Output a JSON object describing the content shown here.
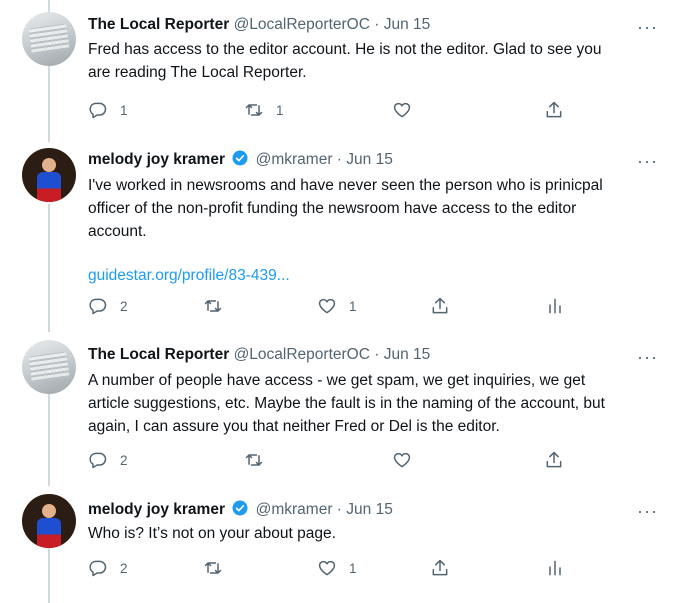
{
  "tweets": [
    {
      "name": "The Local Reporter",
      "handle": "@LocalReporterOC",
      "dot": "·",
      "date": "Jun 15",
      "verified": false,
      "lines": [
        "Fred has access to the editor account.  He is not the editor.  Glad to see you",
        "are reading The Local Reporter."
      ],
      "link": "",
      "reply_count": "1",
      "retweet_count": "1",
      "like_count": "",
      "has_analytics": false
    },
    {
      "name": "melody joy kramer",
      "handle": "@mkramer",
      "dot": "·",
      "date": "Jun 15",
      "verified": true,
      "lines": [
        "I've worked in newsrooms and have never seen the person who is prinicpal",
        "officer of the non-profit funding the newsroom have access to the editor",
        "account."
      ],
      "link": "guidestar.org/profile/83-439...",
      "reply_count": "2",
      "retweet_count": "",
      "like_count": "1",
      "has_analytics": true
    },
    {
      "name": "The Local Reporter",
      "handle": "@LocalReporterOC",
      "dot": "·",
      "date": "Jun 15",
      "verified": false,
      "lines": [
        "A number of people have access - we get spam, we get inquiries, we get",
        "article suggestions, etc.  Maybe the fault is in the naming of the account, but",
        "again, I can assure you that neither Fred or Del is the editor."
      ],
      "link": "",
      "reply_count": "2",
      "retweet_count": "",
      "like_count": "",
      "has_analytics": false
    },
    {
      "name": "melody joy kramer",
      "handle": "@mkramer",
      "dot": "·",
      "date": "Jun 15",
      "verified": true,
      "lines": [
        "Who is? It’s not on your about page."
      ],
      "link": "",
      "reply_count": "2",
      "retweet_count": "",
      "like_count": "1",
      "has_analytics": true
    }
  ],
  "icons": {
    "more": "more-icon",
    "reply": "reply-icon",
    "retweet": "retweet-icon",
    "like": "like-icon",
    "share": "share-icon",
    "analytics": "analytics-icon",
    "verified": "verified-badge-icon"
  },
  "colors": {
    "text": "#0f1419",
    "secondary": "#536471",
    "link": "#1d9bf0",
    "thread_line": "#cfd9de"
  }
}
